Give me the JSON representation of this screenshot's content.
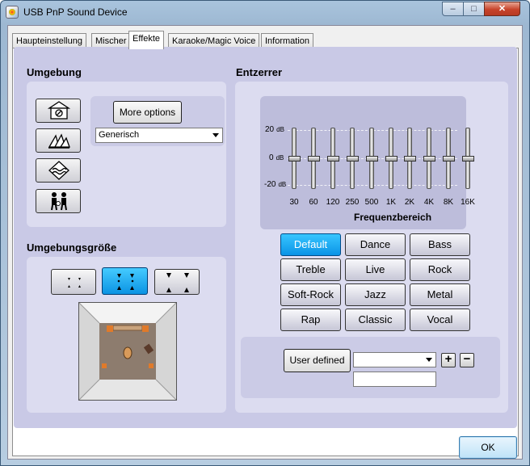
{
  "window": {
    "title": "USB PnP Sound Device"
  },
  "tabs": [
    "Haupteinstellung",
    "Mischer",
    "Effekte",
    "Karaoke/Magic Voice",
    "Information"
  ],
  "active_tab": "Effekte",
  "environment": {
    "title": "Umgebung",
    "more_options_label": "More options",
    "preset_select_value": "Generisch"
  },
  "environment_size": {
    "title": "Umgebungsgröße",
    "selected_index": 1
  },
  "equalizer": {
    "title": "Entzerrer",
    "db_labels": [
      {
        "value": "20",
        "unit": "dB"
      },
      {
        "value": "0",
        "unit": "dB"
      },
      {
        "value": "-20",
        "unit": "dB"
      }
    ],
    "bands": [
      "30",
      "60",
      "120",
      "250",
      "500",
      "1K",
      "2K",
      "4K",
      "8K",
      "16K"
    ],
    "band_gains_db": [
      0,
      0,
      0,
      0,
      0,
      0,
      0,
      0,
      0,
      0
    ],
    "axis_label": "Frequenzbereich",
    "presets": [
      "Default",
      "Dance",
      "Bass",
      "Treble",
      "Live",
      "Rock",
      "Soft-Rock",
      "Jazz",
      "Metal",
      "Rap",
      "Classic",
      "Vocal"
    ],
    "selected_preset": "Default",
    "user_defined_label": "User defined",
    "user_defined_select_value": "",
    "add_symbol": "+",
    "remove_symbol": "−",
    "name_input_value": ""
  },
  "footer": {
    "ok_label": "OK"
  },
  "colors": {
    "selected_blue": "#1aa9f2",
    "panel_bg": "#c9c9e6"
  }
}
